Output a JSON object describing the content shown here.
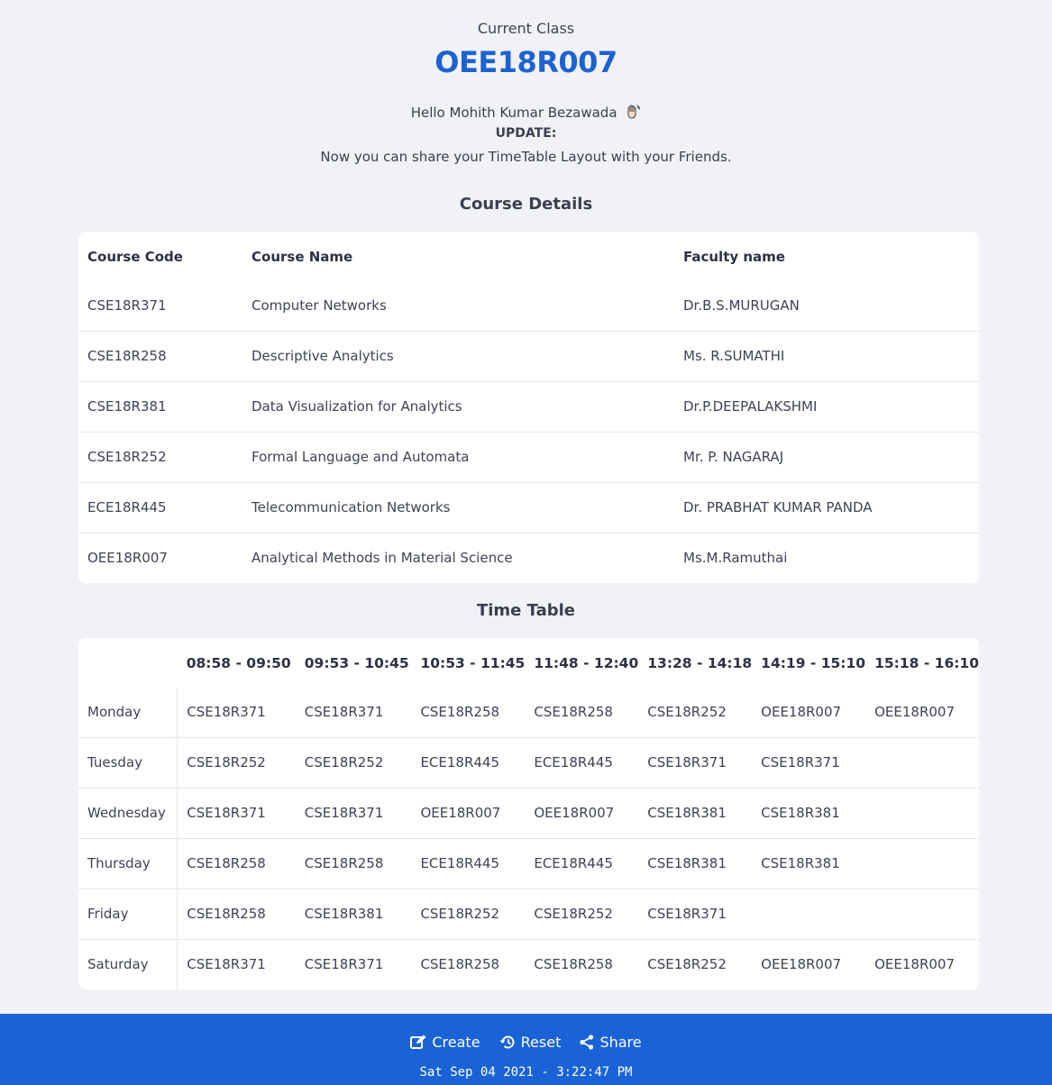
{
  "header": {
    "current_label": "Current Class",
    "class_code": "OEE18R007",
    "hello": "Hello Mohith Kumar Bezawada",
    "update_title": "UPDATE:",
    "update_text": "Now you can share your TimeTable Layout with your Friends."
  },
  "course_details": {
    "title": "Course Details",
    "headers": [
      "Course Code",
      "Course Name",
      "Faculty name"
    ],
    "rows": [
      [
        "CSE18R371",
        "Computer Networks",
        "Dr.B.S.MURUGAN"
      ],
      [
        "CSE18R258",
        "Descriptive Analytics",
        "Ms. R.SUMATHI"
      ],
      [
        "CSE18R381",
        "Data Visualization for Analytics",
        "Dr.P.DEEPALAKSHMI"
      ],
      [
        "CSE18R252",
        "Formal Language and Automata",
        "Mr. P. NAGARAJ"
      ],
      [
        "ECE18R445",
        "Telecommunication Networks",
        "Dr. PRABHAT KUMAR PANDA"
      ],
      [
        "OEE18R007",
        "Analytical Methods in Material Science",
        "Ms.M.Ramuthai"
      ]
    ]
  },
  "timetable": {
    "title": "Time Table",
    "slots": [
      "08:58 - 09:50",
      "09:53 - 10:45",
      "10:53 - 11:45",
      "11:48 - 12:40",
      "13:28 - 14:18",
      "14:19 - 15:10",
      "15:18 - 16:10"
    ],
    "days": [
      {
        "day": "Monday",
        "cells": [
          "CSE18R371",
          "CSE18R371",
          "CSE18R258",
          "CSE18R258",
          "CSE18R252",
          "OEE18R007",
          "OEE18R007"
        ]
      },
      {
        "day": "Tuesday",
        "cells": [
          "CSE18R252",
          "CSE18R252",
          "ECE18R445",
          "ECE18R445",
          "CSE18R371",
          "CSE18R371",
          ""
        ]
      },
      {
        "day": "Wednesday",
        "cells": [
          "CSE18R371",
          "CSE18R371",
          "OEE18R007",
          "OEE18R007",
          "CSE18R381",
          "CSE18R381",
          ""
        ]
      },
      {
        "day": "Thursday",
        "cells": [
          "CSE18R258",
          "CSE18R258",
          "ECE18R445",
          "ECE18R445",
          "CSE18R381",
          "CSE18R381",
          ""
        ]
      },
      {
        "day": "Friday",
        "cells": [
          "CSE18R258",
          "CSE18R381",
          "CSE18R252",
          "CSE18R252",
          "CSE18R371",
          "",
          ""
        ]
      },
      {
        "day": "Saturday",
        "cells": [
          "CSE18R371",
          "CSE18R371",
          "CSE18R258",
          "CSE18R258",
          "CSE18R252",
          "OEE18R007",
          "OEE18R007"
        ]
      }
    ]
  },
  "footer": {
    "create_label": "Create",
    "reset_label": "Reset",
    "share_label": "Share",
    "datetime": "Sat Sep 04 2021 - 3:22:47 PM",
    "icons": [
      "edit-icon",
      "history-icon",
      "share-icon"
    ],
    "background_color": "#1a63d6"
  },
  "colors": {
    "accent": "#1e62d0",
    "page_background": "#f1f2f6"
  }
}
